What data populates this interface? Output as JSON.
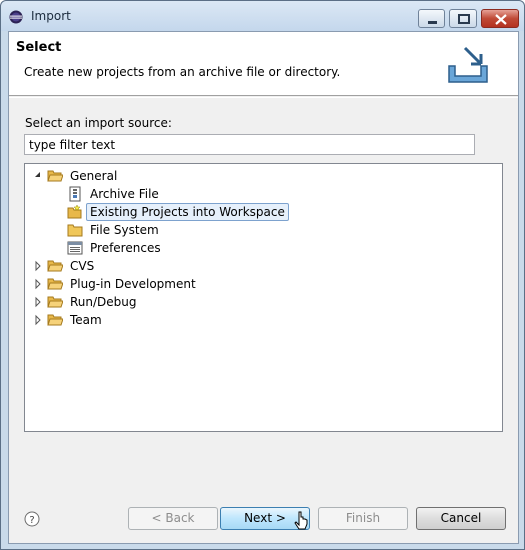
{
  "window": {
    "title": "Import"
  },
  "banner": {
    "title": "Select",
    "description": "Create new projects from an archive file or directory."
  },
  "source": {
    "label": "Select an import source:",
    "filter_value": "type filter text"
  },
  "tree": {
    "general": {
      "label": "General",
      "expanded": true,
      "children": {
        "archive": "Archive File",
        "existing": "Existing Projects into Workspace",
        "filesystem": "File System",
        "preferences": "Preferences"
      },
      "selected": "Existing Projects into Workspace"
    },
    "cvs": "CVS",
    "plugin": "Plug-in Development",
    "rundebug": "Run/Debug",
    "team": "Team"
  },
  "buttons": {
    "back": "< Back",
    "next": "Next >",
    "finish": "Finish",
    "cancel": "Cancel"
  },
  "colors": {
    "folder": "#e8b84a",
    "selection": "#e6f0fb",
    "accent": "#3c7fb1"
  }
}
